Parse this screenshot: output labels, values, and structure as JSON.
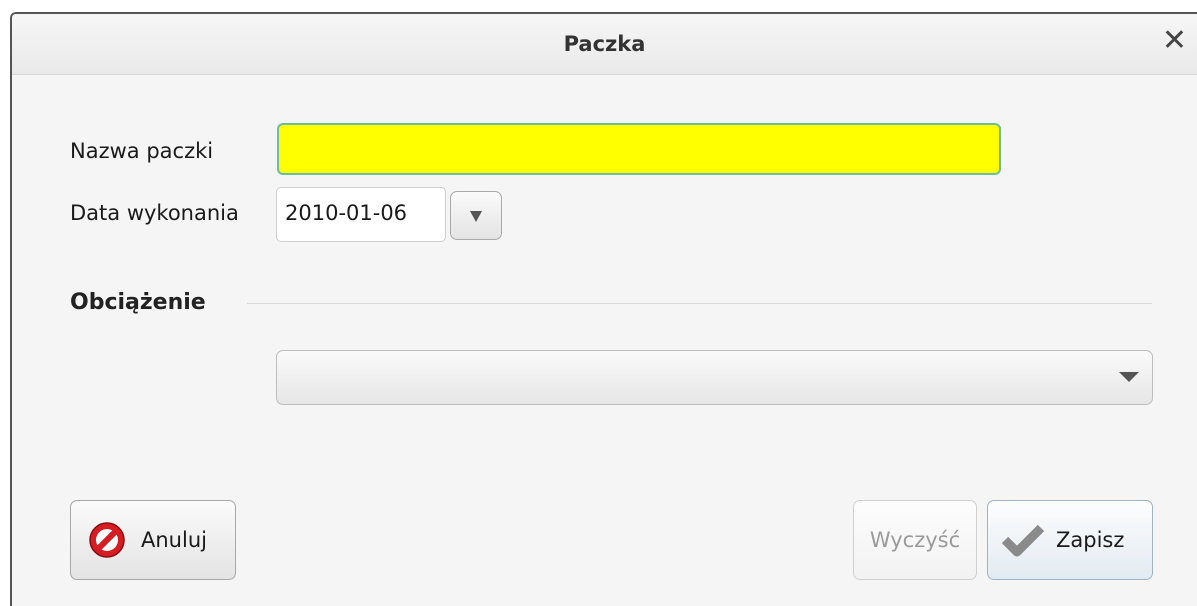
{
  "dialog": {
    "title": "Paczka",
    "close_glyph": "✕",
    "close_icon": "close-icon"
  },
  "form": {
    "name_label": "Nazwa paczki",
    "name_value": "",
    "date_label": "Data wykonania",
    "date_value": "2010-01-06",
    "date_button_icon": "triangle-down-icon"
  },
  "section": {
    "title": "Obciążenie",
    "combo_value": "",
    "combo_icon": "triangle-down-icon"
  },
  "buttons": {
    "cancel_label": "Anuluj",
    "cancel_icon": "forbidden-icon",
    "clear_label": "Wyczyść",
    "save_label": "Zapisz",
    "save_icon": "checkmark-icon"
  },
  "colors": {
    "required_field": "#ffff00",
    "field_border": "#6cbd9d",
    "cancel_icon": "#d71d24"
  }
}
